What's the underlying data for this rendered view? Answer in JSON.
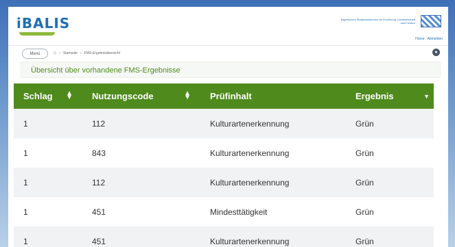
{
  "header": {
    "logo": "iBALIS",
    "ministry": "Bayerisches Staatsministerium für Ernährung, Landwirtschaft und Forsten",
    "links": [
      "Home",
      "Abmelden"
    ]
  },
  "nav": {
    "menu_label": "Menü",
    "breadcrumb": [
      "Startseite",
      "FMS-Ergebnisübersicht"
    ]
  },
  "page": {
    "title": "Übersicht über vorhandene FMS-Ergebnisse"
  },
  "table": {
    "columns": [
      "Schlag",
      "Nutzungscode",
      "Prüfinhalt",
      "Ergebnis"
    ],
    "rows": [
      [
        "1",
        "112",
        "Kulturartenerkennung",
        "Grün"
      ],
      [
        "1",
        "843",
        "Kulturartenerkennung",
        "Grün"
      ],
      [
        "1",
        "112",
        "Kulturartenerkennung",
        "Grün"
      ],
      [
        "1",
        "451",
        "Mindesttätigkeit",
        "Grün"
      ],
      [
        "1",
        "451",
        "Kulturartenerkennung",
        "Grün"
      ]
    ]
  },
  "colors": {
    "header_green": "#4f8a1c",
    "brand_blue": "#1f6fb2"
  }
}
